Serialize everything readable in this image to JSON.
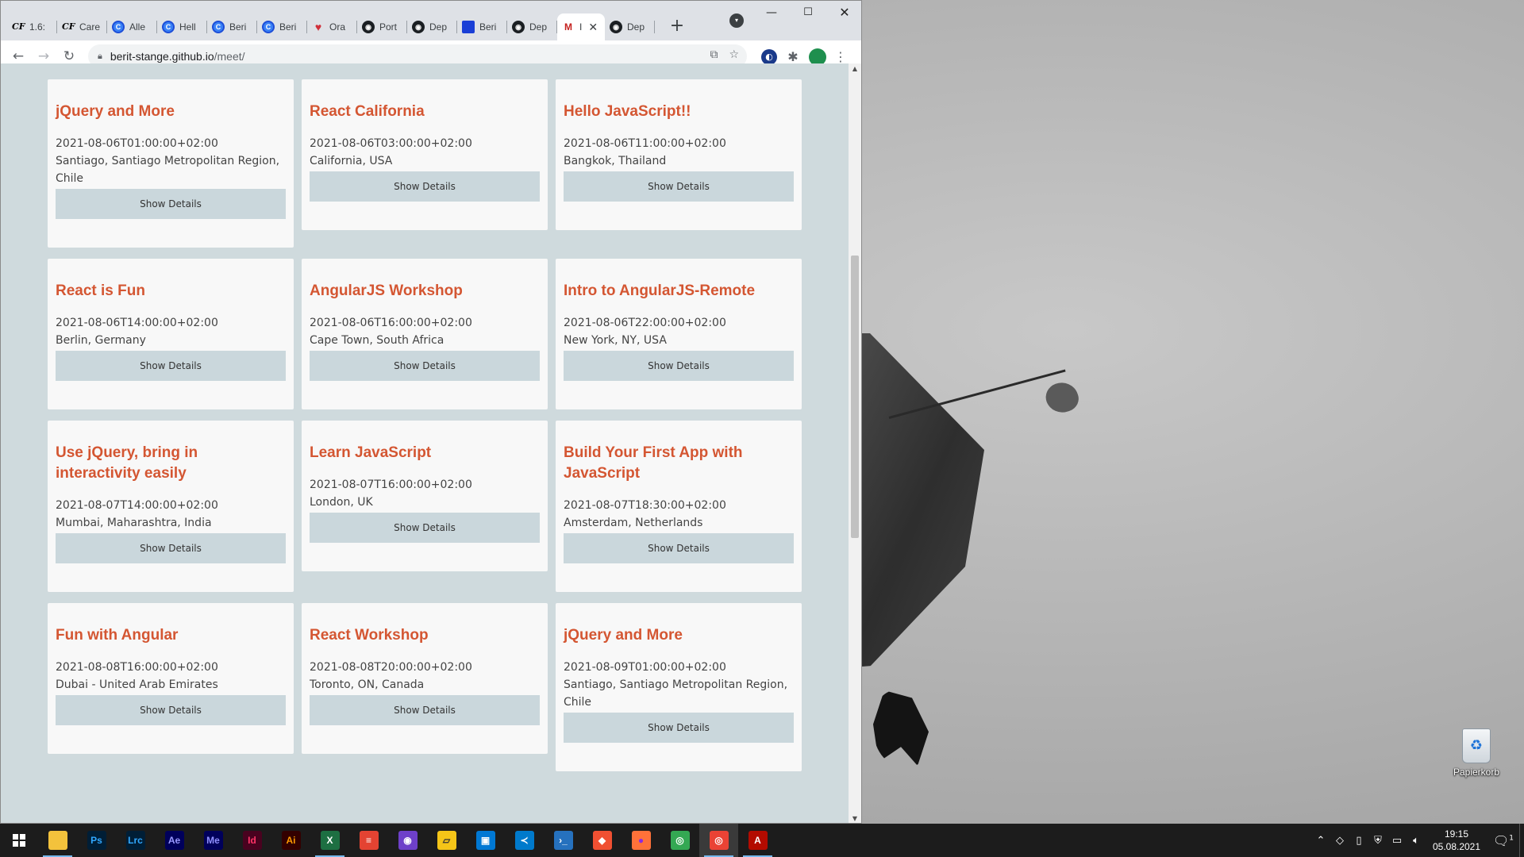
{
  "browser": {
    "tabs": [
      {
        "favicon": "cf-icon",
        "fav_glyph": "CF",
        "label": "1.6:",
        "active": false
      },
      {
        "favicon": "cf-icon",
        "fav_glyph": "CF",
        "label": "Care",
        "active": false
      },
      {
        "favicon": "c-icon",
        "fav_glyph": "C",
        "label": "Alle",
        "active": false
      },
      {
        "favicon": "c-icon",
        "fav_glyph": "C",
        "label": "Hell",
        "active": false
      },
      {
        "favicon": "c-icon",
        "fav_glyph": "C",
        "label": "Beri",
        "active": false
      },
      {
        "favicon": "c-icon",
        "fav_glyph": "C",
        "label": "Beri",
        "active": false
      },
      {
        "favicon": "ora-icon",
        "fav_glyph": "♥",
        "label": "Ora",
        "active": false
      },
      {
        "favicon": "github-icon",
        "fav_glyph": "◉",
        "label": "Port",
        "active": false
      },
      {
        "favicon": "github-icon",
        "fav_glyph": "◉",
        "label": "Dep",
        "active": false
      },
      {
        "favicon": "blue-square-icon",
        "fav_glyph": "",
        "label": "Beri",
        "active": false
      },
      {
        "favicon": "github-icon",
        "fav_glyph": "◉",
        "label": "Dep",
        "active": false
      },
      {
        "favicon": "gmail-icon",
        "fav_glyph": "M",
        "label": "I",
        "active": true
      },
      {
        "favicon": "github-icon",
        "fav_glyph": "◉",
        "label": "Dep",
        "active": false
      }
    ],
    "new_tab": "+",
    "url_host": "berit-stange.github.io",
    "url_path": "/meet/"
  },
  "events": [
    {
      "title": "jQuery and More",
      "date": "2021-08-06T01:00:00+02:00",
      "location": "Santiago, Santiago Metropolitan Region, Chile"
    },
    {
      "title": "React California",
      "date": "2021-08-06T03:00:00+02:00",
      "location": "California, USA"
    },
    {
      "title": "Hello JavaScript!!",
      "date": "2021-08-06T11:00:00+02:00",
      "location": "Bangkok, Thailand"
    },
    {
      "title": "React is Fun",
      "date": "2021-08-06T14:00:00+02:00",
      "location": "Berlin, Germany"
    },
    {
      "title": "AngularJS Workshop",
      "date": "2021-08-06T16:00:00+02:00",
      "location": "Cape Town, South Africa"
    },
    {
      "title": "Intro to AngularJS-Remote",
      "date": "2021-08-06T22:00:00+02:00",
      "location": "New York, NY, USA"
    },
    {
      "title": "Use jQuery, bring in interactivity easily",
      "date": "2021-08-07T14:00:00+02:00",
      "location": "Mumbai, Maharashtra, India"
    },
    {
      "title": "Learn JavaScript",
      "date": "2021-08-07T16:00:00+02:00",
      "location": "London, UK"
    },
    {
      "title": "Build Your First App with JavaScript",
      "date": "2021-08-07T18:30:00+02:00",
      "location": "Amsterdam, Netherlands"
    },
    {
      "title": "Fun with Angular",
      "date": "2021-08-08T16:00:00+02:00",
      "location": "Dubai - United Arab Emirates"
    },
    {
      "title": "React Workshop",
      "date": "2021-08-08T20:00:00+02:00",
      "location": "Toronto, ON, Canada"
    },
    {
      "title": "jQuery and More",
      "date": "2021-08-09T01:00:00+02:00",
      "location": "Santiago, Santiago Metropolitan Region, Chile"
    }
  ],
  "details_label": "Show Details",
  "colors": {
    "page_background": "#cfdadd",
    "card_background": "#f8f8f8",
    "title": "#d45632",
    "button": "#cad7dc"
  },
  "desktop": {
    "recycle_bin_label": "Papierkorb"
  },
  "taskbar": {
    "apps": [
      {
        "name": "file-explorer-icon",
        "glyph": "",
        "bg": "#f3c23c",
        "color": "#000",
        "running": true
      },
      {
        "name": "photoshop-icon",
        "glyph": "Ps",
        "bg": "#001e36",
        "color": "#31a8ff",
        "running": false
      },
      {
        "name": "lightroom-classic-icon",
        "glyph": "Lrc",
        "bg": "#001e36",
        "color": "#31a8ff",
        "running": false
      },
      {
        "name": "after-effects-icon",
        "glyph": "Ae",
        "bg": "#00005b",
        "color": "#9999ff",
        "running": false
      },
      {
        "name": "media-encoder-icon",
        "glyph": "Me",
        "bg": "#00005b",
        "color": "#8f8fff",
        "running": false
      },
      {
        "name": "indesign-icon",
        "glyph": "Id",
        "bg": "#49021f",
        "color": "#ff3366",
        "running": false
      },
      {
        "name": "illustrator-icon",
        "glyph": "Ai",
        "bg": "#330000",
        "color": "#ff9a00",
        "running": false
      },
      {
        "name": "excel-icon",
        "glyph": "X",
        "bg": "#1d6f42",
        "color": "#fff",
        "running": true
      },
      {
        "name": "todoist-icon",
        "glyph": "≡",
        "bg": "#e44332",
        "color": "#fff",
        "running": false
      },
      {
        "name": "github-desktop-icon",
        "glyph": "◉",
        "bg": "#6e40c9",
        "color": "#fff",
        "running": false
      },
      {
        "name": "sticky-notes-icon",
        "glyph": "▱",
        "bg": "#f5c518",
        "color": "#333",
        "running": false
      },
      {
        "name": "windows-store-icon",
        "glyph": "▣",
        "bg": "#0078d4",
        "color": "#fff",
        "running": false
      },
      {
        "name": "vscode-icon",
        "glyph": "≺",
        "bg": "#007acc",
        "color": "#fff",
        "running": false
      },
      {
        "name": "powershell-icon",
        "glyph": "›_",
        "bg": "#2671be",
        "color": "#fff",
        "running": false
      },
      {
        "name": "git-icon",
        "glyph": "◆",
        "bg": "#f05032",
        "color": "#fff",
        "running": false
      },
      {
        "name": "firefox-icon",
        "glyph": "●",
        "bg": "#ff7139",
        "color": "#8a2be2",
        "running": false
      },
      {
        "name": "chrome-icon",
        "glyph": "◎",
        "bg": "#34a853",
        "color": "#fff",
        "running": false
      },
      {
        "name": "chrome-active-icon",
        "glyph": "◎",
        "bg": "#ea4335",
        "color": "#fff",
        "running": true,
        "active": true
      },
      {
        "name": "acrobat-icon",
        "glyph": "A",
        "bg": "#b30b00",
        "color": "#fff",
        "running": true
      }
    ],
    "clock_time": "19:15",
    "clock_date": "05.08.2021",
    "notification_count": "1"
  }
}
